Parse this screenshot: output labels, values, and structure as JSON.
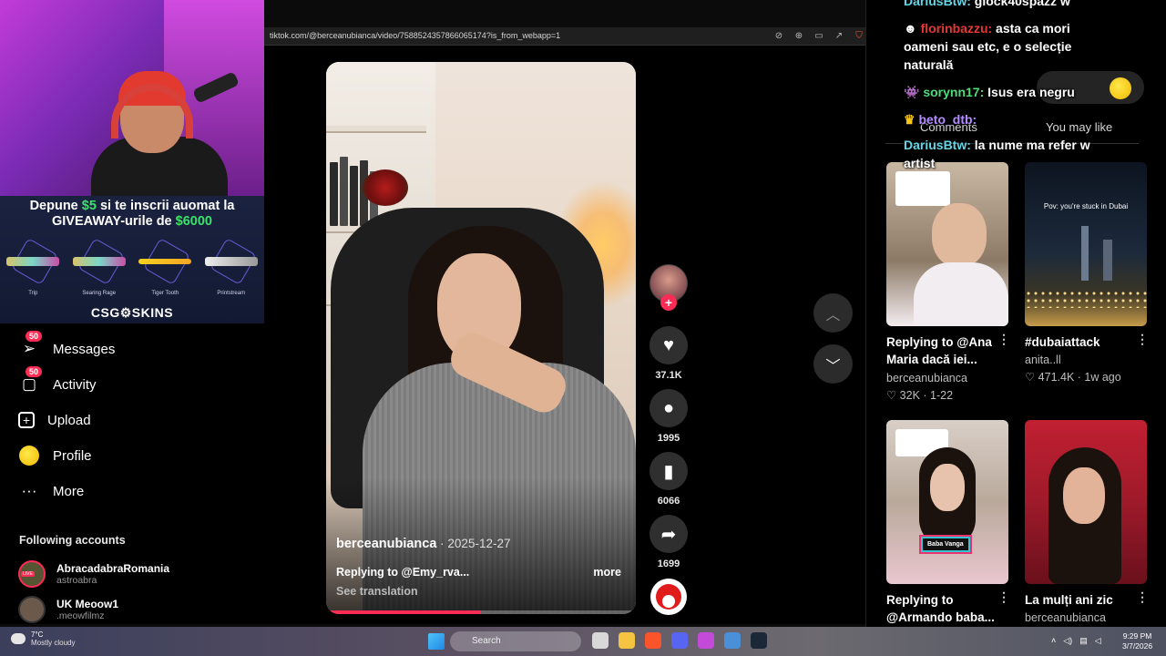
{
  "browser": {
    "url": "tiktok.com/@berceanubianca/video/7588524357866065174?is_from_webapp=1"
  },
  "promo": {
    "line1_prefix": "Depune ",
    "line1_amount": "$5",
    "line1_suffix": " si te inscrii auomat la",
    "line2_prefix": "GIVEAWAY-urile de ",
    "line2_amount": "$6000",
    "skins": [
      "Trip",
      "Searing Rage",
      "Tiger Tooth",
      "Printstream"
    ],
    "brand": "CSG⚙SKINS"
  },
  "sidebar": {
    "items": [
      {
        "label": "Messages",
        "badge": "50",
        "icon": "paper-plane-icon"
      },
      {
        "label": "Activity",
        "badge": "50",
        "icon": "chat-bubble-icon"
      },
      {
        "label": "Upload",
        "icon": "plus-square-icon"
      },
      {
        "label": "Profile",
        "icon": "avatar-icon"
      },
      {
        "label": "More",
        "icon": "ellipsis-icon"
      }
    ],
    "following_title": "Following accounts",
    "accounts": [
      {
        "name": "AbracadabraRomania",
        "handle": "astroabra",
        "live": "LIVE"
      },
      {
        "name": "UK Meoow1",
        "handle": ".meowfilmz"
      }
    ]
  },
  "video": {
    "author": "berceanubianca",
    "date": " · 2025-12-27",
    "description": "Replying to @Emy_rva...",
    "more": "more",
    "translate": "See translation",
    "progress": 0.5,
    "likes": "37.1K",
    "comments": "1995",
    "saves": "6066",
    "shares": "1699",
    "follow_symbol": "+"
  },
  "right": {
    "tab_comments": "Comments",
    "tab_like": "You may like",
    "cards": [
      {
        "title": "Replying to @Ana Maria dacă iei...",
        "author": "berceanubianca",
        "meta": "♡ 32K · 1-22"
      },
      {
        "title": "#dubaiattack",
        "author": "anita..ll",
        "meta": "♡ 471.4K · 1w ago",
        "overlay": "Pov: you're stuck in Dubai"
      },
      {
        "title": "Replying to @Armando baba...",
        "author": "",
        "meta": "",
        "tag": "Baba Vanga"
      },
      {
        "title": "La mulți ani zic",
        "author": "berceanubianca",
        "meta": ""
      }
    ]
  },
  "chat": [
    {
      "user": "DariusBtw:",
      "text": " glock40spazz w",
      "color": "blue"
    },
    {
      "user": "florinbazzu:",
      "text": " asta ca mori",
      "color": "red"
    },
    {
      "user": "",
      "text": "oameni sau etc, e o selecție",
      "color": ""
    },
    {
      "user": "",
      "text": "naturală",
      "color": ""
    },
    {
      "user": "sorynn17:",
      "text": " Isus era negru",
      "color": "green"
    },
    {
      "user": "beto_dtb:",
      "text": "",
      "color": "purple"
    },
    {
      "user": "DariusBtw:",
      "text": " la nume ma refer w",
      "color": "blue"
    },
    {
      "user": "",
      "text": "artist",
      "color": ""
    }
  ],
  "taskbar": {
    "temp": "7°C",
    "weather": "Mostly cloudy",
    "search": "Search",
    "time": "9:29 PM",
    "date": "3/7/2026"
  }
}
